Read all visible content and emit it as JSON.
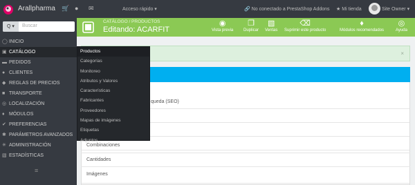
{
  "topbar": {
    "store_name": "Arallpharma",
    "quick_access": "Acceso rápido ▾",
    "not_connected": "No conectado a PrestaShop Addons",
    "my_store": "Mi tienda",
    "user": "Site Owner ▾"
  },
  "sidebar": {
    "search_button": "Q ▾",
    "search_placeholder": "Buscar",
    "items": [
      {
        "label": "INICIO",
        "icon": "dashboard-icon"
      },
      {
        "label": "CATÁLOGO",
        "icon": "book-icon"
      },
      {
        "label": "PEDIDOS",
        "icon": "credit-card-icon"
      },
      {
        "label": "CLIENTES",
        "icon": "users-icon"
      },
      {
        "label": "REGLAS DE PRECIOS",
        "icon": "tag-icon"
      },
      {
        "label": "TRANSPORTE",
        "icon": "truck-icon"
      },
      {
        "label": "LOCALIZACIÓN",
        "icon": "globe-icon"
      },
      {
        "label": "MÓDULOS",
        "icon": "puzzle-icon"
      },
      {
        "label": "PREFERENCIAS",
        "icon": "wrench-icon"
      },
      {
        "label": "PARÁMETROS AVANZADOS",
        "icon": "cogs-icon"
      },
      {
        "label": "ADMINISTRACIÓN",
        "icon": "cog-icon"
      },
      {
        "label": "ESTADÍSTICAS",
        "icon": "bar-chart-icon"
      }
    ],
    "collapse": "≡"
  },
  "catalog_submenu": [
    "Productos",
    "Categorías",
    "Monitoreo",
    "Atributos y Valores",
    "Características",
    "Fabricantes",
    "Proveedores",
    "Mapas de imágenes",
    "Etiquetas",
    "Adjuntos"
  ],
  "header": {
    "breadcrumb": "CATÁLOGO  /  PRODUCTOS",
    "title": "Editando: ACARFIT",
    "buttons": [
      {
        "label": "Vista previa",
        "icon": "eye-icon"
      },
      {
        "label": "Duplicar",
        "icon": "copy-icon"
      },
      {
        "label": "Ventas",
        "icon": "bar-chart-icon"
      },
      {
        "label": "Suprimir este producto",
        "icon": "trash-icon"
      },
      {
        "label": "Módulos recomendados",
        "icon": "puzzle-icon"
      },
      {
        "label": "Ayuda",
        "icon": "life-ring-icon"
      }
    ]
  },
  "content": {
    "alert_close": "×",
    "seo_fragment": "queda (SEO)",
    "rows": [
      "Combinaciones",
      "Cantidades",
      "Imágenes"
    ]
  }
}
